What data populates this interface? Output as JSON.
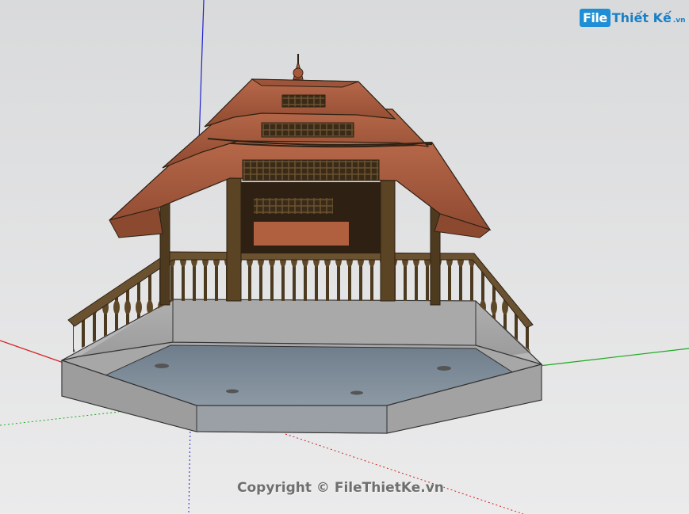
{
  "watermark": {
    "logo_part1": "File",
    "logo_part2": "Thiết Kế",
    "logo_part3": ".vn"
  },
  "copyright": "Copyright © FileThietKe.vn",
  "colors": {
    "background": "#e4e4e4",
    "roof_tile": "#a8573a",
    "wood": "#5a4424",
    "wood_dark": "#2e2114",
    "concrete_side": "#a6a6a6",
    "underside": "#7f8b97",
    "axis_red": "#d42020",
    "axis_green": "#1caa1c",
    "axis_blue": "#2020d0",
    "logo_blue": "#1e8fd6"
  }
}
